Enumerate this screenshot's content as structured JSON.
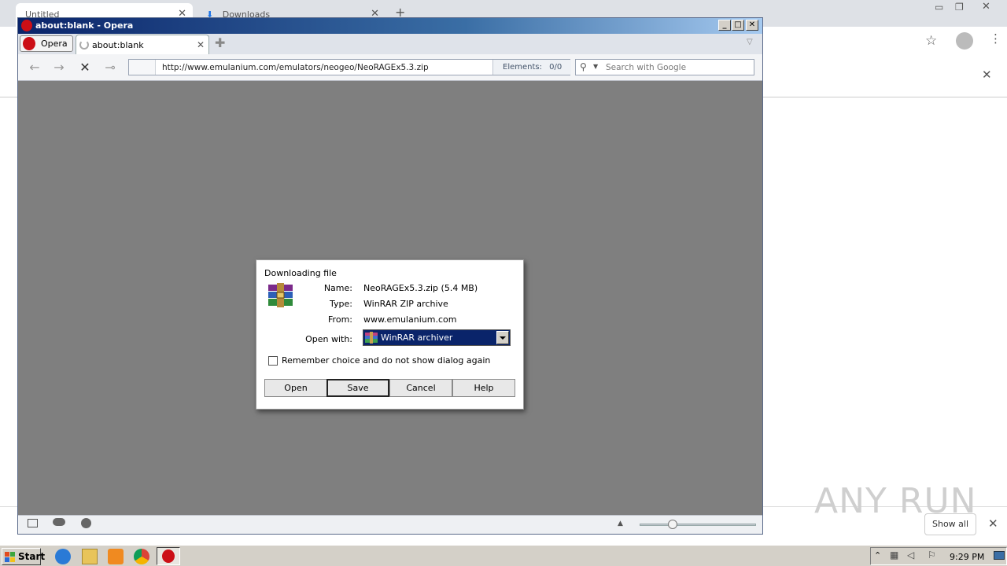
{
  "chrome": {
    "tabs": [
      {
        "label": "Untitled"
      },
      {
        "label": "Downloads"
      }
    ],
    "show_all_label": "Show all",
    "watermark": "ANY RUN"
  },
  "opera": {
    "window_title": "about:blank - Opera",
    "menu_label": "Opera",
    "tab_label": "about:blank",
    "address": "http://www.emulanium.com/emulators/neogeo/NeoRAGEx5.3.zip",
    "elements_label": "Elements:",
    "elements_value": "0/0",
    "search_placeholder": "Search with Google"
  },
  "dialog": {
    "title": "Downloading file",
    "name_label": "Name:",
    "name_value": "NeoRAGEx5.3.zip (5.4 MB)",
    "type_label": "Type:",
    "type_value": "WinRAR ZIP archive",
    "from_label": "From:",
    "from_value": "www.emulanium.com",
    "open_with_label": "Open with:",
    "open_with_value": "WinRAR archiver",
    "remember_label": "Remember choice and do not show dialog again",
    "remember_checked": false,
    "buttons": {
      "open": "Open",
      "save": "Save",
      "cancel": "Cancel",
      "help": "Help"
    }
  },
  "taskbar": {
    "start_label": "Start",
    "clock": "9:29 PM"
  }
}
